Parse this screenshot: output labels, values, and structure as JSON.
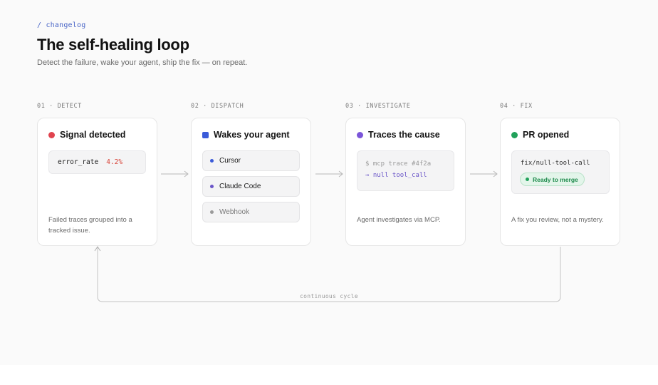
{
  "header": {
    "eyebrow": "/ changelog",
    "title": "The self-healing loop",
    "subtitle": "Detect the failure, wake your agent, ship the fix — on repeat."
  },
  "steps": [
    {
      "label": "01 · DETECT",
      "title": "Signal detected",
      "icon": "red-dot-icon",
      "accent": "#e0444f",
      "metric": {
        "name": "error_rate",
        "value": "4.2%"
      },
      "footer": "Failed traces grouped into a tracked issue."
    },
    {
      "label": "02 · DISPATCH",
      "title": "Wakes your agent",
      "icon": "blue-square-icon",
      "accent": "#3b5bd9",
      "agents": [
        {
          "label": "Cursor",
          "dot": "#3b5bd9"
        },
        {
          "label": "Claude Code",
          "dot": "#6a55c8"
        },
        {
          "label": "Webhook",
          "dot": "#9a9a9a"
        }
      ]
    },
    {
      "label": "03 · INVESTIGATE",
      "title": "Traces the cause",
      "icon": "purple-dot-icon",
      "accent": "#7b55d9",
      "code": [
        "$ mcp trace #4f2a",
        "→ null tool_call"
      ],
      "footer": "Agent investigates via MCP."
    },
    {
      "label": "04 · FIX",
      "title": "PR opened",
      "icon": "green-dot-icon",
      "accent": "#21a15a",
      "branch": "fix/null-tool-call",
      "badge": "Ready to merge",
      "footer": "A fix you review, not a mystery."
    }
  ],
  "loop": {
    "label": "continuous cycle"
  }
}
